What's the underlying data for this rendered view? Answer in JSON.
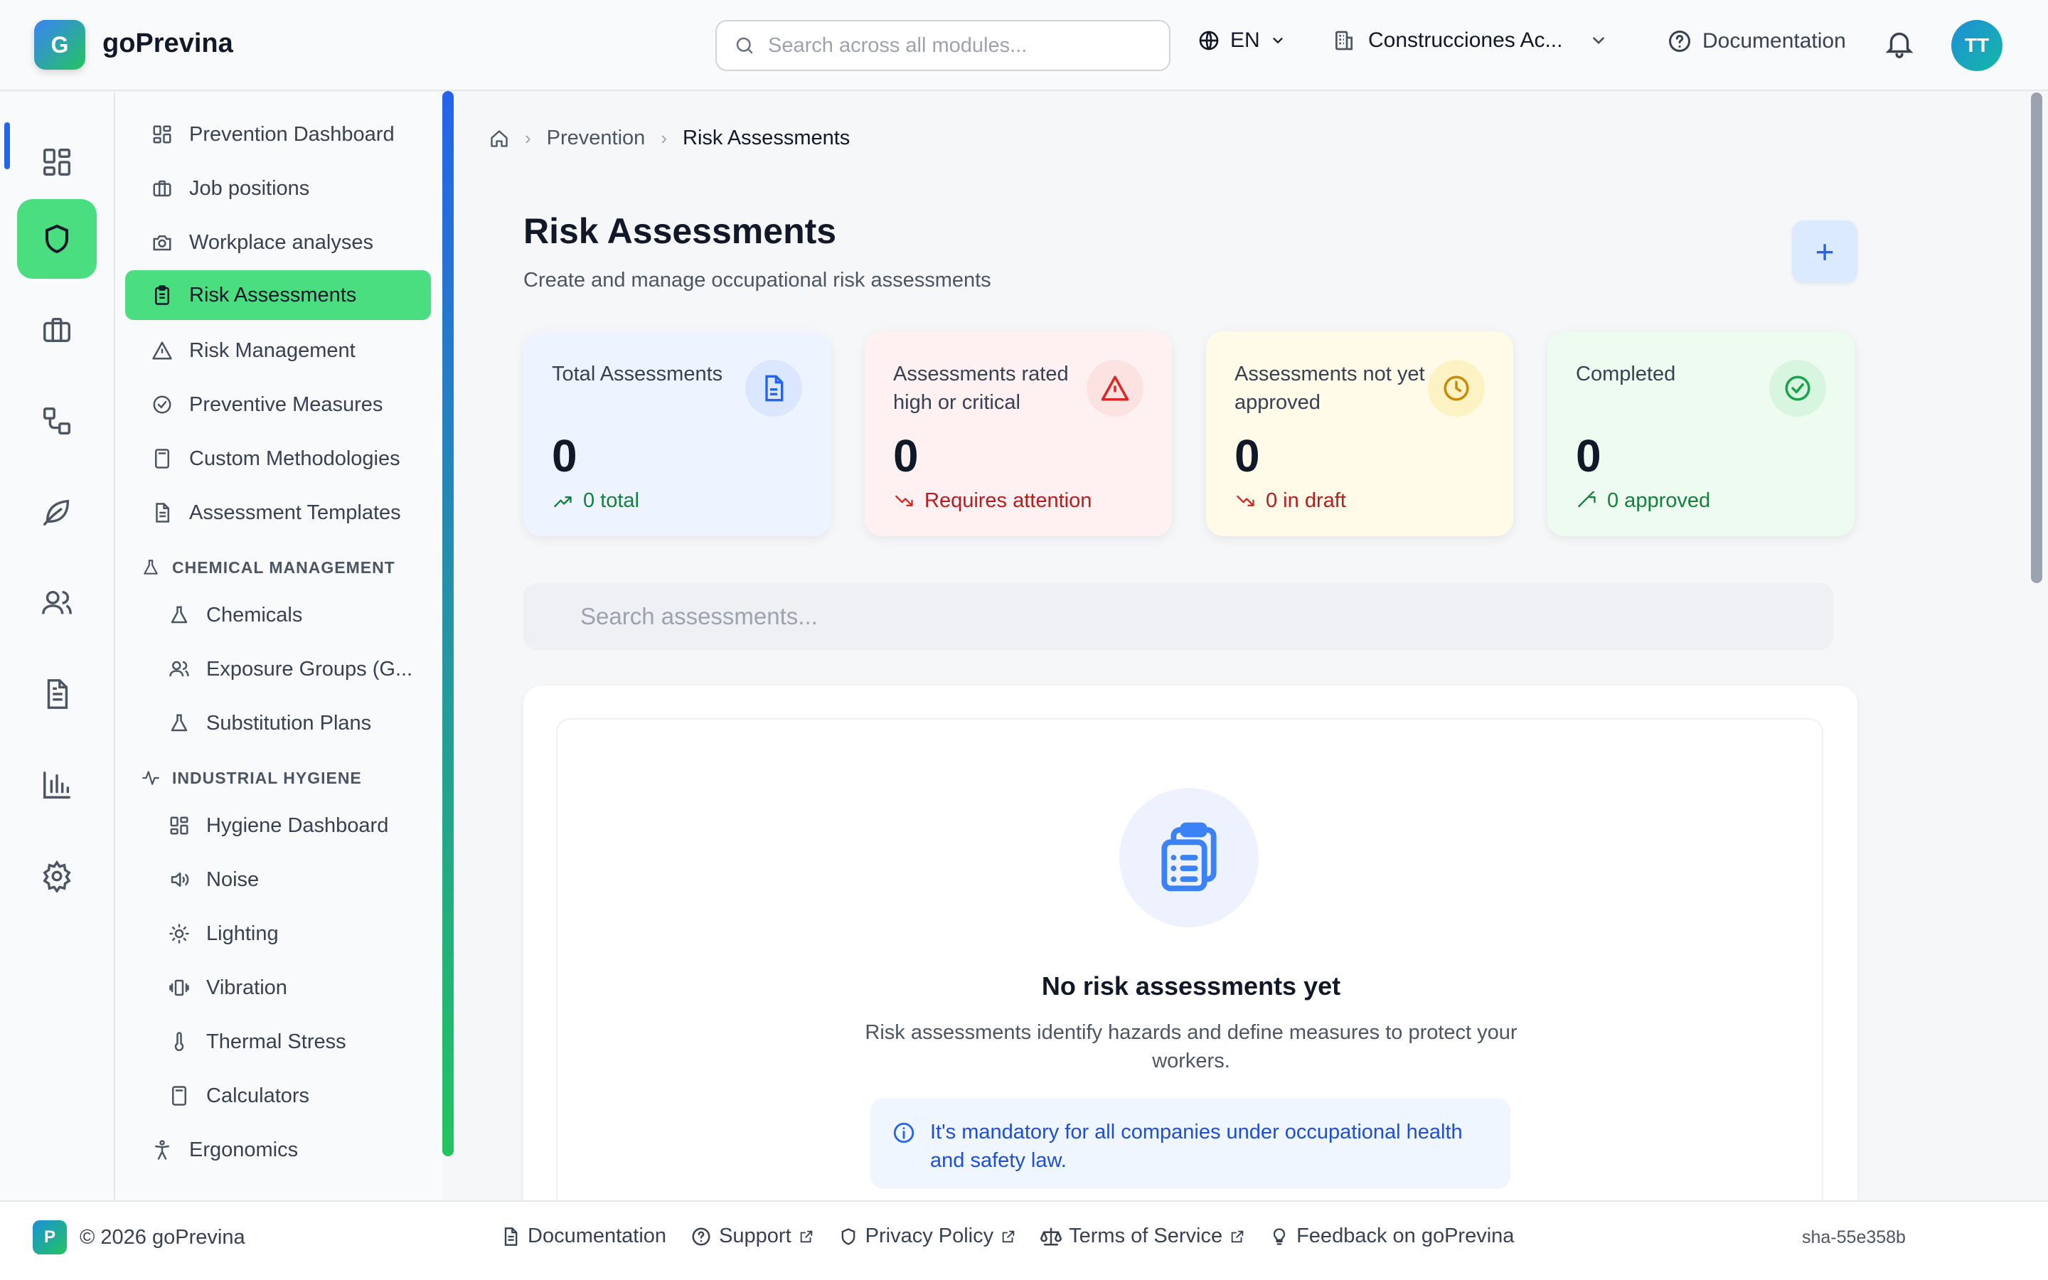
{
  "app": {
    "logo_letter": "G",
    "name": "goPrevina"
  },
  "topbar": {
    "search_placeholder": "Search across all modules...",
    "language": "EN",
    "company": "Construcciones Ac...",
    "documentation": "Documentation",
    "avatar_initials": "TT"
  },
  "rail": {
    "items": [
      "dashboard-icon",
      "shield-icon",
      "briefcase-icon",
      "workflow-icon",
      "leaf-icon",
      "users-icon",
      "document-icon",
      "bar-chart-icon",
      "gear-icon"
    ],
    "active": "shield-icon"
  },
  "nav": {
    "items": [
      {
        "label": "Prevention Dashboard",
        "icon": "dashboard-icon"
      },
      {
        "label": "Job positions",
        "icon": "briefcase-icon"
      },
      {
        "label": "Workplace analyses",
        "icon": "camera-icon"
      },
      {
        "label": "Risk Assessments",
        "icon": "clipboard-icon",
        "active": true
      },
      {
        "label": "Risk Management",
        "icon": "warning-icon"
      },
      {
        "label": "Preventive Measures",
        "icon": "check-circle-icon"
      },
      {
        "label": "Custom Methodologies",
        "icon": "calculator-icon"
      },
      {
        "label": "Assessment Templates",
        "icon": "document-icon"
      }
    ],
    "section_chemical": "CHEMICAL MANAGEMENT",
    "chemical_items": [
      {
        "label": "Chemicals",
        "icon": "flask-icon"
      },
      {
        "label": "Exposure Groups (G...",
        "icon": "users-icon"
      },
      {
        "label": "Substitution Plans",
        "icon": "flask-icon"
      }
    ],
    "section_hygiene": "INDUSTRIAL HYGIENE",
    "hygiene_items": [
      {
        "label": "Hygiene Dashboard",
        "icon": "dashboard-icon"
      },
      {
        "label": "Noise",
        "icon": "speaker-icon"
      },
      {
        "label": "Lighting",
        "icon": "sun-icon"
      },
      {
        "label": "Vibration",
        "icon": "vibration-icon"
      },
      {
        "label": "Thermal Stress",
        "icon": "thermometer-icon"
      },
      {
        "label": "Calculators",
        "icon": "calculator-icon"
      }
    ],
    "ergonomics": "Ergonomics"
  },
  "breadcrumb": {
    "section": "Prevention",
    "current": "Risk Assessments"
  },
  "page": {
    "title": "Risk Assessments",
    "subtitle": "Create and manage occupational risk assessments",
    "add_symbol": "+"
  },
  "stats": [
    {
      "label": "Total Assessments",
      "value": "0",
      "trend": "0 total",
      "trend_dir": "up",
      "bg": "#eef4ff",
      "icon_bg": "#dbe7ff",
      "color": "#2563eb",
      "trend_color": "#15803d",
      "icon": "file-icon"
    },
    {
      "label": "Assessments rated high or critical",
      "value": "0",
      "trend": "Requires attention",
      "trend_dir": "down",
      "bg": "#fff1f1",
      "icon_bg": "#fde2e2",
      "color": "#dc2626",
      "trend_color": "#b91c1c",
      "icon": "alert-triangle-icon"
    },
    {
      "label": "Assessments not yet approved",
      "value": "0",
      "trend": "0 in draft",
      "trend_dir": "down",
      "bg": "#fffbe8",
      "icon_bg": "#fdf2c4",
      "color": "#ca8a04",
      "trend_color": "#b91c1c",
      "icon": "clock-icon"
    },
    {
      "label": "Completed",
      "value": "0",
      "trend": "0 approved",
      "trend_dir": "up",
      "bg": "#eefbf1",
      "icon_bg": "#d8f5e0",
      "color": "#16a34a",
      "trend_color": "#15803d",
      "icon": "check-circle-icon"
    }
  ],
  "search": {
    "placeholder": "Search assessments..."
  },
  "empty": {
    "title": "No risk assessments yet",
    "text": "Risk assessments identify hazards and define measures to protect your workers.",
    "notice": "It's mandatory for all companies under occupational health and safety law."
  },
  "footer": {
    "badge": "P",
    "copyright": "© 2026 goPrevina",
    "links": [
      "Documentation",
      "Support",
      "Privacy Policy",
      "Terms of Service",
      "Feedback on goPrevina"
    ],
    "sha": "sha-55e358b"
  }
}
